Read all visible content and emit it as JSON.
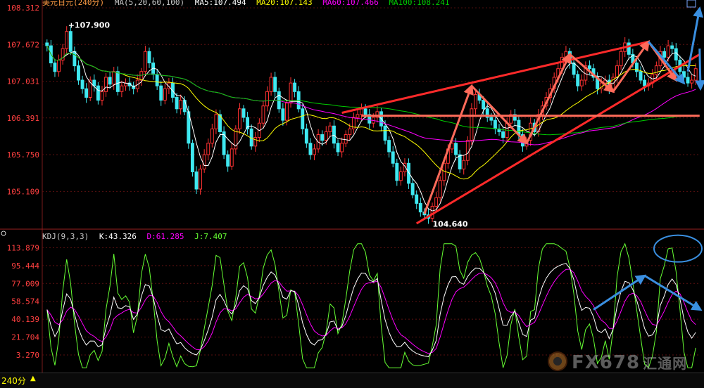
{
  "header": {
    "title": "美元日元(240分)",
    "ma_params": "MA(5,20,60,100)",
    "ma5": "MA5:107.494",
    "ma20": "MA20:107.143",
    "ma60": "MA60:107.466",
    "ma100": "MA100:108.241"
  },
  "kdj_header": {
    "label": "KDJ(9,3,3)",
    "k": "K:43.326",
    "d": "D:61.285",
    "j": "J:7.407"
  },
  "footer": {
    "period": "240分",
    "caret": "▲"
  },
  "watermark": {
    "text": "FX678",
    "suffix": "汇通网"
  },
  "colors": {
    "up": "#ff3232",
    "down": "#3fe8f0",
    "ma5": "#ffffff",
    "ma20": "#ffff00",
    "ma60": "#ff00ff",
    "ma100": "#00cc00",
    "kdj_k": "#ffffff",
    "kdj_d": "#ff00ff",
    "kdj_j": "#66ff33",
    "annot_red": "#ff2a2a",
    "annot_salmon": "#ff6b5a",
    "annot_blue": "#3a8fe0"
  },
  "chart_data": [
    {
      "type": "candlestick",
      "title": "美元日元(240分)",
      "ylim": [
        104.5,
        108.35
      ],
      "y_ticks": [
        "108.312",
        "107.672",
        "107.031",
        "106.391",
        "105.750",
        "105.109"
      ],
      "y_tick_values": [
        108.312,
        107.672,
        107.031,
        106.391,
        105.75,
        105.109
      ],
      "grid": true,
      "annotations": [
        {
          "text": "+107.900",
          "index": 5,
          "value": 107.9
        },
        {
          "text": "104.640",
          "index": 97,
          "value": 104.64
        }
      ],
      "trendlines": [
        {
          "color": "red",
          "from": [
            75,
            106.48
          ],
          "to": [
            153,
            107.72
          ]
        },
        {
          "color": "red",
          "from": [
            94,
            104.55
          ],
          "to": [
            166,
            107.5
          ]
        },
        {
          "color": "salmon",
          "from": [
            80,
            106.43
          ],
          "to": [
            166,
            106.43
          ]
        }
      ],
      "zigzag_salmon": [
        [
          96,
          104.72
        ],
        [
          108,
          106.95
        ],
        [
          122,
          105.95
        ],
        [
          133,
          107.5
        ],
        [
          144,
          106.85
        ],
        [
          153,
          107.72
        ],
        [
          160,
          107.05
        ]
      ],
      "blue_arrows": [
        [
          [
            153,
            107.72
          ],
          [
            162,
            107.0
          ]
        ],
        [
          [
            163,
            107.2
          ],
          [
            166,
            108.3
          ]
        ],
        [
          [
            166,
            107.6
          ],
          [
            168,
            106.9
          ]
        ]
      ],
      "close": [
        107.65,
        107.35,
        107.2,
        107.4,
        107.6,
        107.9,
        107.55,
        107.3,
        107.05,
        106.9,
        106.75,
        107.05,
        106.95,
        106.7,
        106.85,
        107.1,
        106.98,
        107.2,
        106.85,
        106.95,
        107.0,
        106.95,
        106.9,
        107.05,
        107.2,
        107.55,
        107.35,
        107.15,
        106.95,
        106.7,
        106.9,
        107.0,
        106.75,
        106.55,
        106.7,
        106.5,
        105.95,
        105.45,
        105.15,
        105.5,
        105.75,
        105.95,
        106.2,
        106.45,
        106.15,
        105.75,
        105.55,
        105.85,
        106.2,
        106.55,
        106.4,
        106.2,
        105.9,
        106.05,
        106.3,
        106.6,
        106.85,
        107.1,
        106.85,
        106.55,
        106.35,
        106.65,
        107.0,
        106.85,
        106.55,
        106.2,
        105.95,
        105.75,
        105.85,
        106.1,
        106.0,
        106.15,
        106.25,
        105.95,
        105.8,
        105.95,
        106.1,
        106.2,
        106.4,
        106.45,
        106.55,
        106.45,
        106.3,
        106.4,
        106.5,
        106.25,
        106.0,
        105.8,
        105.6,
        105.3,
        105.45,
        105.6,
        105.25,
        105.05,
        104.9,
        104.75,
        104.7,
        104.64,
        104.85,
        105.0,
        105.3,
        105.6,
        105.85,
        105.95,
        105.75,
        105.5,
        105.65,
        106.0,
        106.55,
        106.8,
        106.7,
        106.55,
        106.4,
        106.35,
        106.2,
        106.15,
        106.05,
        106.3,
        106.45,
        106.35,
        106.1,
        105.9,
        106.0,
        106.3,
        106.15,
        106.45,
        106.6,
        106.75,
        106.9,
        107.1,
        107.25,
        107.45,
        107.55,
        107.35,
        107.15,
        106.95,
        107.05,
        107.3,
        107.25,
        107.1,
        106.9,
        107.0,
        107.05,
        106.9,
        107.1,
        107.3,
        107.55,
        107.7,
        107.5,
        107.35,
        107.2,
        107.05,
        106.95,
        107.0,
        107.15,
        107.3,
        107.55,
        107.45,
        107.65,
        107.6,
        107.4,
        107.2,
        107.1,
        107.0,
        107.05,
        107.25
      ]
    },
    {
      "type": "line",
      "title": "KDJ(9,3,3)",
      "ylim": [
        -12,
        120
      ],
      "y_ticks": [
        "113.879",
        "95.444",
        "77.009",
        "58.574",
        "40.139",
        "21.704",
        "3.270"
      ],
      "y_tick_values": [
        113.879,
        95.444,
        77.009,
        58.574,
        40.139,
        21.704,
        3.27
      ],
      "grid": true,
      "blue_arrows": [
        [
          [
            139,
            50
          ],
          [
            152,
            85
          ]
        ],
        [
          [
            152,
            85
          ],
          [
            168,
            50
          ]
        ]
      ],
      "blue_ellipse": {
        "index": 163,
        "value": 113
      }
    }
  ]
}
